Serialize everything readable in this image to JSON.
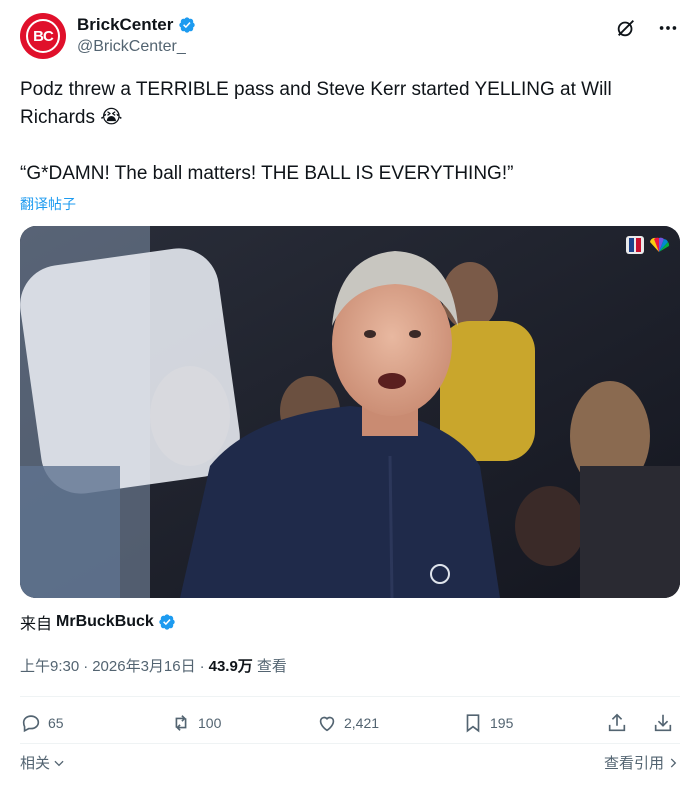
{
  "colors": {
    "accent": "#1d9bf0",
    "text_primary": "#0f1419",
    "text_secondary": "#536471",
    "avatar_bg": "#e0102b"
  },
  "author": {
    "avatar_text": "BC",
    "display_name": "BrickCenter",
    "handle": "@BrickCenter_",
    "verified_icon": "verified-badge-icon"
  },
  "tweet": {
    "line1": "Podz threw a TERRIBLE pass and Steve Kerr started YELLING at Will Richards 😭",
    "quote": "“G*DAMN! The ball matters! THE BALL IS EVERYTHING!”",
    "translate_label": "翻译帖子"
  },
  "media": {
    "broadcast_icon": "nbc-peacock-icon"
  },
  "source": {
    "prefix": "来自",
    "user": "MrBuckBuck"
  },
  "meta": {
    "time": "上午9:30",
    "sep1": "·",
    "date": "2026年3月16日",
    "sep2": "·",
    "views_count": "43.9万",
    "views_label": "查看"
  },
  "actions": {
    "replies": "65",
    "reposts": "100",
    "likes": "2,421",
    "bookmarks": "195"
  },
  "footer": {
    "related": "相关",
    "view_quotes": "查看引用"
  }
}
